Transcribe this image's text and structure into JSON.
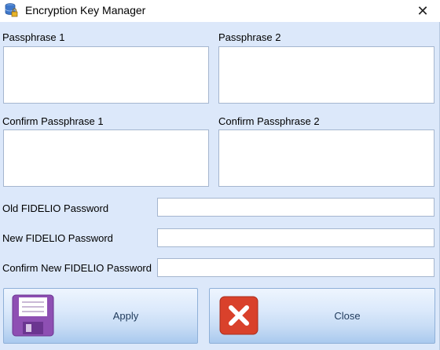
{
  "window": {
    "title": "Encryption Key Manager"
  },
  "icons": {
    "app": "database-lock-icon",
    "close": "close-icon",
    "apply": "floppy-disk-icon",
    "cancel": "red-x-icon"
  },
  "glyphs": {
    "close": "✕"
  },
  "labels": {
    "passphrase1": "Passphrase 1",
    "passphrase2": "Passphrase 2",
    "confirm_passphrase1": "Confirm Passphrase 1",
    "confirm_passphrase2": "Confirm Passphrase 2",
    "old_password": "Old FIDELIO Password",
    "new_password": "New FIDELIO Password",
    "confirm_new_password": "Confirm New FIDELIO Password"
  },
  "values": {
    "passphrase1": "",
    "passphrase2": "",
    "confirm_passphrase1": "",
    "confirm_passphrase2": "",
    "old_password": "",
    "new_password": "",
    "confirm_new_password": ""
  },
  "buttons": {
    "apply": "Apply",
    "close": "Close"
  },
  "colors": {
    "background": "#dce8fa",
    "apply_icon": "#8e4fb3",
    "close_icon": "#d9412b"
  }
}
